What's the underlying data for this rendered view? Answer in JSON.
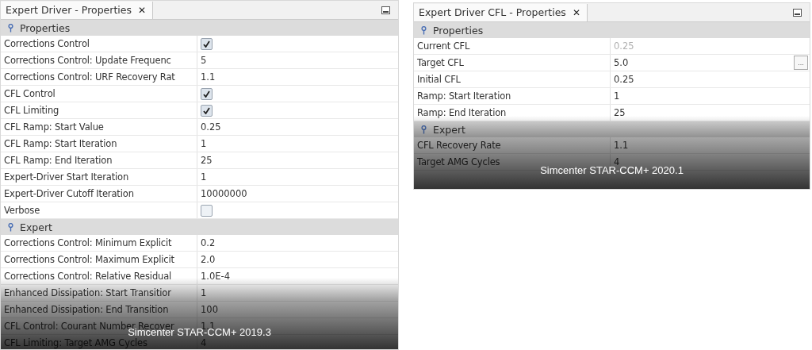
{
  "panels": [
    {
      "title": "Expert Driver - Properties",
      "close": "✕",
      "caption": "Simcenter STAR-CCM+ 2019.3",
      "sections": [
        {
          "title": "Properties",
          "rows": [
            {
              "label": "Corrections Control",
              "kind": "check",
              "checked": true
            },
            {
              "label": "Corrections Control: Update Frequenc",
              "kind": "text",
              "value": "5"
            },
            {
              "label": "Corrections Control: URF Recovery Rat",
              "kind": "text",
              "value": "1.1"
            },
            {
              "label": "CFL Control",
              "kind": "check",
              "checked": true
            },
            {
              "label": "CFL Limiting",
              "kind": "check",
              "checked": true
            },
            {
              "label": "CFL Ramp: Start Value",
              "kind": "text",
              "value": "0.25"
            },
            {
              "label": "CFL Ramp: Start Iteration",
              "kind": "text",
              "value": "1"
            },
            {
              "label": "CFL Ramp: End Iteration",
              "kind": "text",
              "value": "25"
            },
            {
              "label": "Expert-Driver Start Iteration",
              "kind": "text",
              "value": "1"
            },
            {
              "label": "Expert-Driver Cutoff Iteration",
              "kind": "text",
              "value": "10000000"
            },
            {
              "label": "Verbose",
              "kind": "check",
              "checked": false
            }
          ]
        },
        {
          "title": "Expert",
          "rows": [
            {
              "label": "Corrections Control: Minimum Explicit",
              "kind": "text",
              "value": "0.2"
            },
            {
              "label": "Corrections Control: Maximum Explicit",
              "kind": "text",
              "value": "2.0"
            },
            {
              "label": "Corrections Control: Relative Residual",
              "kind": "text",
              "value": "1.0E-4"
            },
            {
              "label": "Enhanced Dissipation: Start Transitior",
              "kind": "text",
              "value": "1"
            },
            {
              "label": "Enhanced Dissipation: End Transition",
              "kind": "text",
              "value": "100"
            },
            {
              "label": "CFL Control: Courant Number Recover",
              "kind": "text",
              "value": "1.1"
            },
            {
              "label": "CFL Limiting: Target AMG Cycles",
              "kind": "text",
              "value": "4"
            }
          ]
        }
      ]
    },
    {
      "title": "Expert Driver CFL - Properties",
      "close": "✕",
      "caption": "Simcenter STAR-CCM+ 2020.1",
      "sections": [
        {
          "title": "Properties",
          "rows": [
            {
              "label": "Current CFL",
              "kind": "text",
              "value": "0.25",
              "disabled": true
            },
            {
              "label": "Target CFL",
              "kind": "text",
              "value": "5.0",
              "button": "..."
            },
            {
              "label": "Initial CFL",
              "kind": "text",
              "value": "0.25"
            },
            {
              "label": "Ramp: Start Iteration",
              "kind": "text",
              "value": "1"
            },
            {
              "label": "Ramp: End Iteration",
              "kind": "text",
              "value": "25"
            }
          ]
        },
        {
          "title": "Expert",
          "rows": [
            {
              "label": "CFL Recovery Rate",
              "kind": "text",
              "value": "1.1"
            },
            {
              "label": "Target AMG Cycles",
              "kind": "text",
              "value": "4"
            }
          ]
        }
      ]
    }
  ]
}
